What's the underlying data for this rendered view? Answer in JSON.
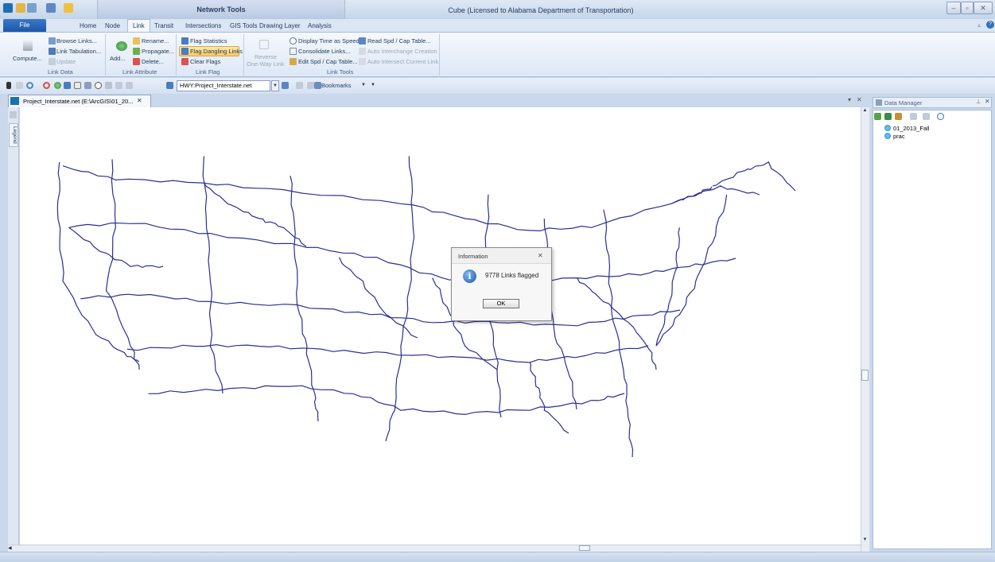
{
  "title_bar": {
    "context_title": "Network Tools",
    "app_title": "Cube (Licensed to Alabama Department of Transportation)"
  },
  "ribbon": {
    "file_tab": "File",
    "tabs": [
      "Home",
      "Node",
      "Link",
      "Transit",
      "Intersections",
      "GIS Tools",
      "Drawing Layer",
      "Analysis"
    ],
    "active_tab": "Link",
    "groups": {
      "link_data": {
        "label": "Link Data",
        "compute": "Compute...",
        "browse_links": "Browse Links...",
        "link_tabulation": "Link Tabulation...",
        "update": "Update"
      },
      "link_attribute": {
        "label": "Link Attribute",
        "add": "Add...",
        "rename": "Rename...",
        "propagate": "Propagate...",
        "delete": "Delete..."
      },
      "link_flag": {
        "label": "Link Flag",
        "flag_statistics": "Flag Statistics",
        "flag_dangling_links": "Flag Dangling Links",
        "clear_flags": "Clear Flags"
      },
      "reverse": {
        "line1": "Reverse",
        "line2": "One-Way Link"
      },
      "link_tools": {
        "label": "Link Tools",
        "display_time_as_speed": "Display Time as Speed",
        "consolidate_links": "Consolidate Links...",
        "edit_spd_cap_table": "Edit Spd / Cap Table...",
        "read_spd_cap_table": "Read Spd / Cap Table...",
        "auto_interchange_creation": "Auto Interchange Creation",
        "auto_intersect_current_link": "Auto Intersect Current Link"
      }
    }
  },
  "toolbar": {
    "layer_combo": "HWY:Project_Interstate.net",
    "bookmarks": "Bookmarks"
  },
  "document": {
    "tab_title": "Project_Interstate.net (E:\\ArcGIS\\01_20...",
    "legend_tab": "Legend"
  },
  "data_manager": {
    "title": "Data Manager",
    "items": [
      "01_2013_Fall",
      "prac"
    ]
  },
  "dialog": {
    "title": "Information",
    "message": "9778 Links flagged",
    "ok": "OK"
  },
  "colors": {
    "network_lines": "#2b2f92",
    "ribbon_bg": "#dde8f6",
    "file_tab": "#1e56a8",
    "highlight": "#f8c864"
  }
}
